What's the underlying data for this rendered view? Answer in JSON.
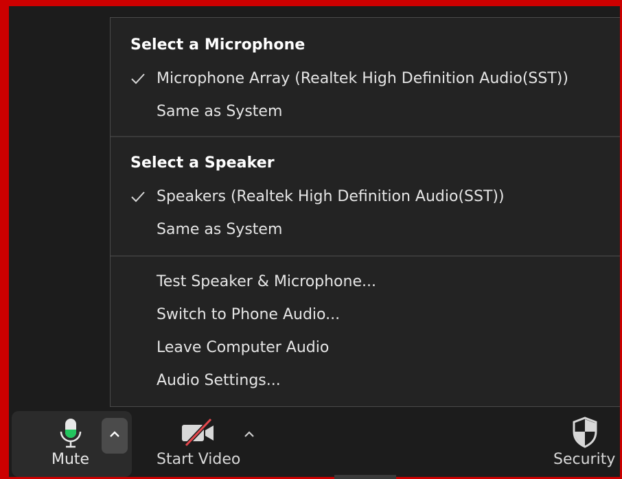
{
  "menu": {
    "microphone": {
      "heading": "Select a Microphone",
      "items": [
        {
          "label": "Microphone Array (Realtek High Definition Audio(SST))",
          "checked": true
        },
        {
          "label": "Same as System",
          "checked": false
        }
      ]
    },
    "speaker": {
      "heading": "Select a Speaker",
      "items": [
        {
          "label": "Speakers (Realtek High Definition Audio(SST))",
          "checked": true
        },
        {
          "label": "Same as System",
          "checked": false
        }
      ]
    },
    "actions": [
      {
        "label": "Test Speaker & Microphone..."
      },
      {
        "label": "Switch to Phone Audio..."
      },
      {
        "label": "Leave Computer Audio"
      },
      {
        "label": "Audio Settings..."
      }
    ]
  },
  "toolbar": {
    "mute_label": "Mute",
    "start_video_label": "Start Video",
    "security_label": "Security",
    "icons": {
      "mic": "microphone-icon",
      "video": "video-off-icon",
      "security": "shield-icon",
      "chevron": "chevron-up-icon"
    }
  },
  "colors": {
    "mic_active": "#22c55e",
    "video_slash": "#e5484d",
    "frame_border": "#cc0000",
    "menu_bg": "#232323"
  }
}
